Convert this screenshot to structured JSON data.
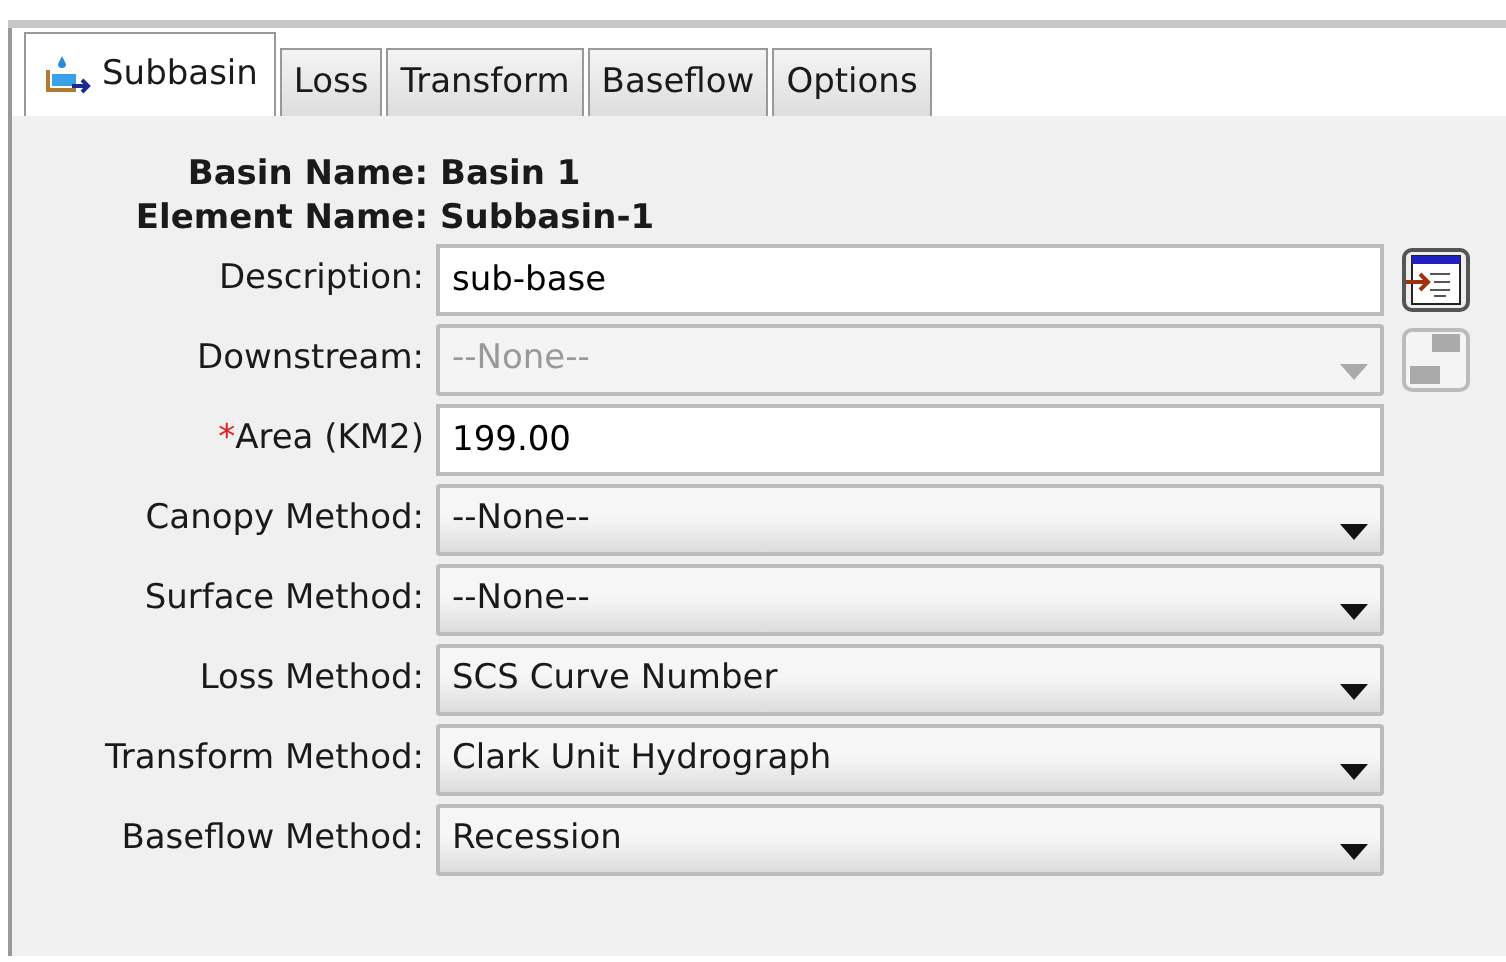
{
  "tabs": [
    {
      "label": "Subbasin",
      "selected": true,
      "kind": "with_icon"
    },
    {
      "label": "Loss",
      "selected": false,
      "kind": "plain"
    },
    {
      "label": "Transform",
      "selected": false,
      "kind": "plain"
    },
    {
      "label": "Baseflow",
      "selected": false,
      "kind": "plain"
    },
    {
      "label": "Options",
      "selected": false,
      "kind": "plain"
    }
  ],
  "headers": [
    {
      "label": "Basin Name:",
      "value": "Basin 1"
    },
    {
      "label": "Element Name:",
      "value": "Subbasin-1"
    }
  ],
  "fields": [
    {
      "label": "Description:",
      "kind": "text",
      "value": "sub-base",
      "disabled": false,
      "side_button": {
        "kind": "editor"
      }
    },
    {
      "label": "Downstream:",
      "kind": "dropdown",
      "value": "--None--",
      "disabled": true,
      "side_button": {
        "kind": "save"
      }
    },
    {
      "label": "Area (KM2)",
      "required_mark": "*",
      "kind": "text",
      "value": "199.00",
      "disabled": false
    },
    {
      "label": "Canopy Method:",
      "kind": "dropdown",
      "value": "--None--",
      "disabled": false
    },
    {
      "label": "Surface Method:",
      "kind": "dropdown",
      "value": "--None--",
      "disabled": false
    },
    {
      "label": "Loss Method:",
      "kind": "dropdown",
      "value": "SCS Curve Number",
      "disabled": false
    },
    {
      "label": "Transform Method:",
      "kind": "dropdown",
      "value": "Clark Unit Hydrograph",
      "disabled": false
    },
    {
      "label": "Baseflow Method:",
      "kind": "dropdown",
      "value": "Recession",
      "disabled": false
    }
  ]
}
